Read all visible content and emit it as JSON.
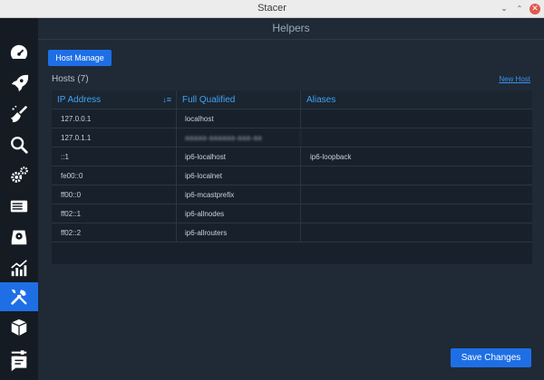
{
  "window": {
    "title": "Stacer"
  },
  "page": {
    "title": "Helpers"
  },
  "toolbar": {
    "host_manage_label": "Host Manage"
  },
  "hosts": {
    "label": "Hosts (7)",
    "new_host_link": "New Host",
    "columns": [
      "IP Address",
      "Full Qualified",
      "Aliases"
    ],
    "rows": [
      {
        "ip": "127.0.0.1",
        "fqdn": "localhost",
        "aliases": ""
      },
      {
        "ip": "127.0.1.1",
        "fqdn": "aaaaa-aaaaaa-aaa-aa",
        "aliases": ""
      },
      {
        "ip": "::1",
        "fqdn": "ip6-localhost",
        "aliases": "ip6-loopback"
      },
      {
        "ip": "fe00::0",
        "fqdn": "ip6-localnet",
        "aliases": ""
      },
      {
        "ip": "ff00::0",
        "fqdn": "ip6-mcastprefix",
        "aliases": ""
      },
      {
        "ip": "ff02::1",
        "fqdn": "ip6-allnodes",
        "aliases": ""
      },
      {
        "ip": "ff02::2",
        "fqdn": "ip6-allrouters",
        "aliases": ""
      }
    ]
  },
  "footer": {
    "save_label": "Save Changes"
  },
  "sidebar": {
    "items": [
      {
        "icon": "dashboard-icon"
      },
      {
        "icon": "rocket-icon"
      },
      {
        "icon": "broom-icon"
      },
      {
        "icon": "search-icon"
      },
      {
        "icon": "gears-icon"
      },
      {
        "icon": "server-icon"
      },
      {
        "icon": "disk-icon"
      },
      {
        "icon": "chart-icon"
      },
      {
        "icon": "tools-icon",
        "active": true
      },
      {
        "icon": "package-icon"
      },
      {
        "icon": "sliders-icon"
      },
      {
        "icon": "feedback-icon"
      }
    ]
  },
  "colors": {
    "accent": "#1e6fe6",
    "header_text": "#3fa3f3",
    "background": "#1f2a36",
    "sidebar": "#141b23"
  }
}
